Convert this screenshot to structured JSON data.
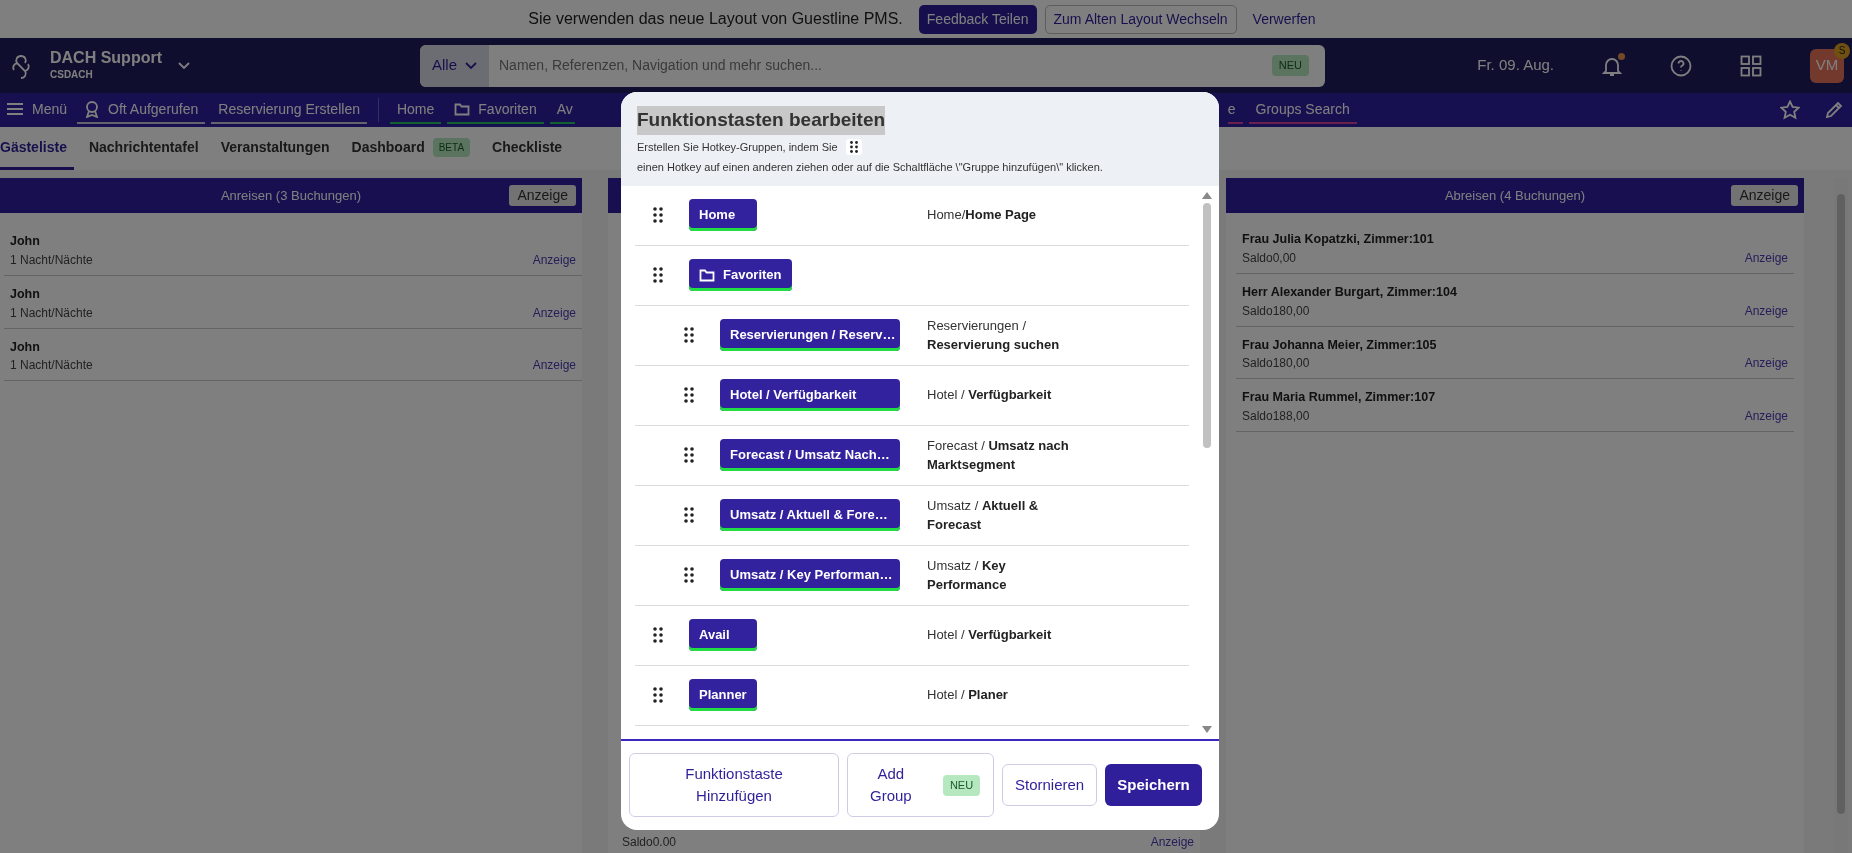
{
  "banner": {
    "message": "Sie verwenden das neue Layout von Guestline PMS.",
    "buttons": [
      {
        "label": "Feedback Teilen",
        "kind": "primary"
      },
      {
        "label": "Zum Alten Layout Wechseln",
        "kind": "outline"
      },
      {
        "label": "Verwerfen",
        "kind": "link"
      }
    ]
  },
  "header": {
    "property": "DACH Support",
    "code": "CSDACH",
    "search": {
      "scope": "Alle",
      "placeholder": "Namen, Referenzen, Navigation und mehr suchen...",
      "badge": "NEU"
    },
    "date": "Fr. 09. Aug.",
    "notifications_unread": true,
    "avatar": {
      "initials": "VM",
      "badge": "S"
    }
  },
  "navbar": {
    "menu": "Menü",
    "links": [
      {
        "label": "Oft Aufgerufen",
        "kind": "recent"
      },
      {
        "label": "Reservierung Erstellen",
        "kind": "action"
      },
      {
        "label": "Home",
        "kind": "hotkey"
      },
      {
        "label": "Favoriten",
        "kind": "folder"
      },
      {
        "label": "Av",
        "kind": "hotkey"
      },
      {
        "label": "e",
        "kind": "search"
      },
      {
        "label": "Groups Search",
        "kind": "search"
      }
    ]
  },
  "tabs": [
    {
      "label": "Gästeliste",
      "selected": true
    },
    {
      "label": "Nachrichtentafel",
      "selected": false
    },
    {
      "label": "Veranstaltungen",
      "selected": false
    },
    {
      "label": "Dashboard",
      "badge": "BETA",
      "selected": false
    },
    {
      "label": "Checkliste",
      "selected": false
    }
  ],
  "panels": [
    {
      "title": "Anreisen (3 Buchungen)",
      "button": "Anzeige",
      "rows": [
        {
          "name": "John",
          "detail": "1 Nacht/Nächte",
          "link": "Anzeige"
        },
        {
          "name": "John",
          "detail": "1 Nacht/Nächte",
          "link": "Anzeige"
        },
        {
          "name": "John",
          "detail": "1 Nacht/Nächte",
          "link": "Anzeige"
        }
      ]
    },
    {
      "rows": [
        {
          "detail": "Saldo0.00",
          "link": "Anzeige"
        }
      ]
    },
    {
      "title": "Abreisen (4 Buchungen)",
      "button": "Anzeige",
      "rows": [
        {
          "name": "Frau Julia Kopatzki, Zimmer:101",
          "detail": "Saldo0,00",
          "link": "Anzeige"
        },
        {
          "name": "Herr Alexander Burgart, Zimmer:104",
          "detail": "Saldo180,00",
          "link": "Anzeige"
        },
        {
          "name": "Frau Johanna Meier, Zimmer:105",
          "detail": "Saldo180,00",
          "link": "Anzeige"
        },
        {
          "name": "Frau Maria Rummel, Zimmer:107",
          "detail": "Saldo188,00",
          "link": "Anzeige"
        }
      ]
    }
  ],
  "modal": {
    "title": "Funktionstasten bearbeiten",
    "description_start": "Erstellen Sie Hotkey-Gruppen, indem Sie",
    "description_end": "einen Hotkey auf einen anderen ziehen oder auf die Schaltfläche \\\"Gruppe hinzufügen\\\" klicken.",
    "hotkeys": [
      {
        "label": "Home",
        "kind": "hotkey",
        "path": "Home/**Home Page**"
      },
      {
        "label": "Favoriten",
        "kind": "folder",
        "children": [
          {
            "label": "Reservierungen / Reserv…",
            "kind": "hotkey",
            "path": "Reservierungen / **Reservierung suchen**"
          },
          {
            "label": "Hotel / Verfügbarkeit",
            "kind": "hotkey",
            "path": "Hotel / **Verfügbarkeit**"
          },
          {
            "label": "Forecast / Umsatz Nach…",
            "kind": "hotkey",
            "path": "Forecast / **Umsatz nach Marktsegment**"
          },
          {
            "label": "Umsatz / Aktuell & Fore…",
            "kind": "hotkey",
            "path": "Umsatz / **Aktuell & Forecast**"
          },
          {
            "label": "Umsatz / Key Performan…",
            "kind": "hotkey",
            "path": "Umsatz / **Key Performance**"
          }
        ]
      },
      {
        "label": "Avail",
        "kind": "hotkey",
        "path": "Hotel / **Verfügbarkeit**"
      },
      {
        "label": "Planner",
        "kind": "hotkey",
        "path": "Hotel / **Planer**"
      }
    ],
    "buttons": [
      {
        "label": "Funktionstaste Hinzufügen",
        "kind": "outline"
      },
      {
        "label": "Add Group",
        "kind": "outline",
        "badge": "NEU"
      },
      {
        "label": "Stornieren",
        "kind": "outline"
      },
      {
        "label": "Speichern",
        "kind": "primary"
      }
    ]
  }
}
